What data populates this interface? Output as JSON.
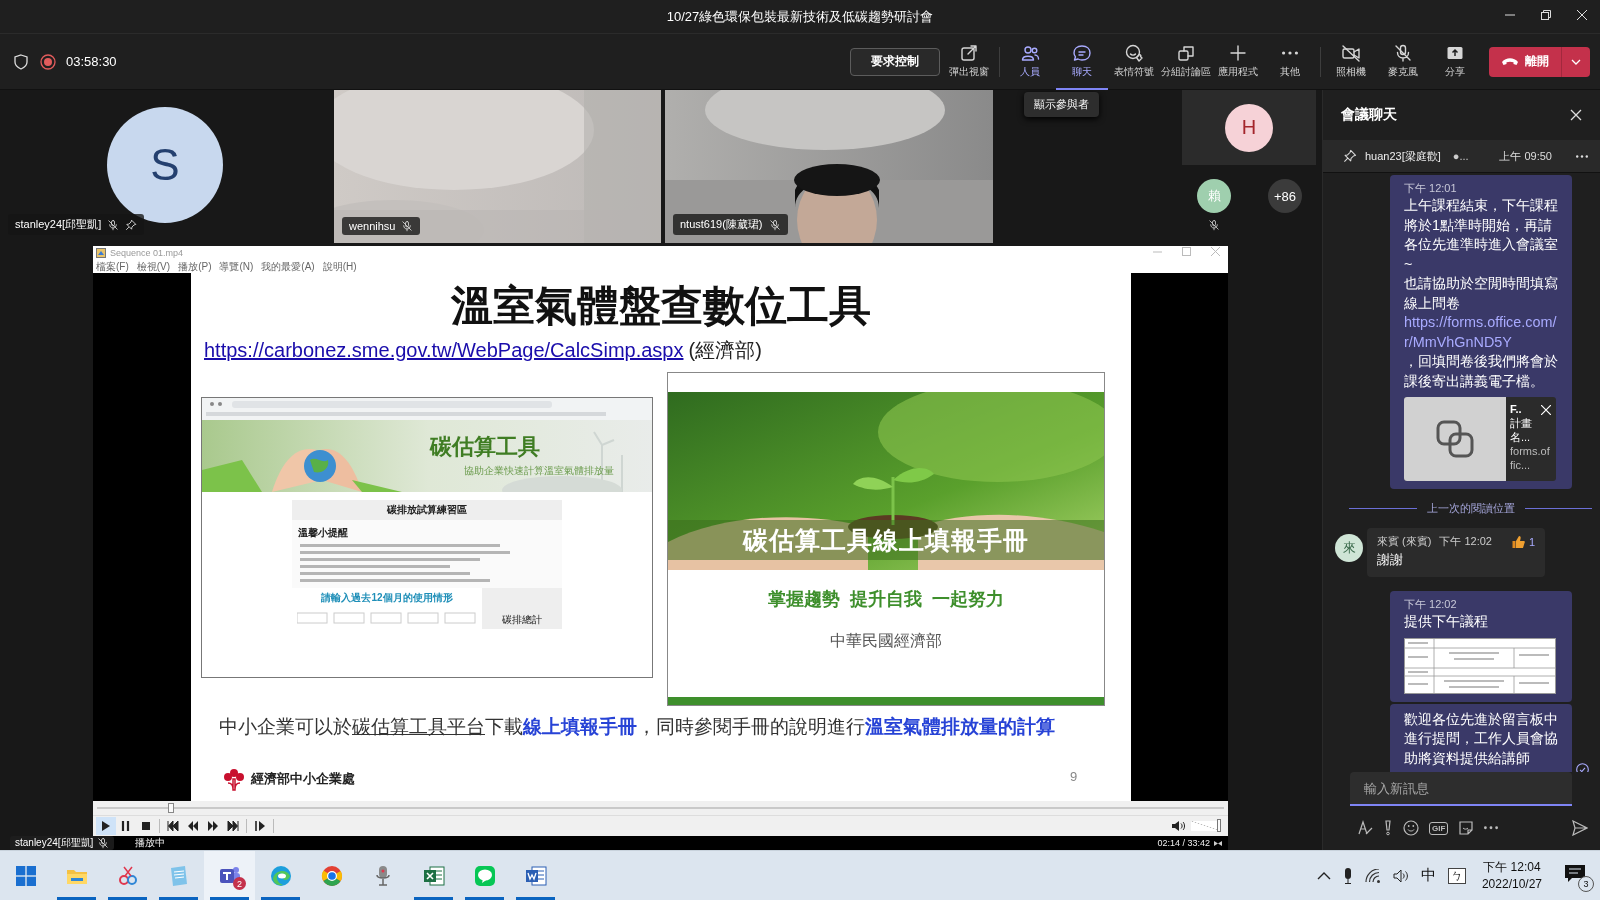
{
  "window": {
    "title": "10/27綠色環保包裝最新技術及低碳趨勢研討會"
  },
  "meeting_bar": {
    "elapsed": "03:58:30",
    "recording": true,
    "request_control": "要求控制",
    "tooltip": "顯示參與者",
    "actions": [
      {
        "label": "彈出視窗",
        "selected": false,
        "hovered": false
      },
      {
        "label": "人員",
        "selected": false,
        "hovered": true
      },
      {
        "label": "聊天",
        "selected": true,
        "hovered": false
      },
      {
        "label": "表情符號",
        "selected": false,
        "hovered": false
      },
      {
        "label": "分組討論區",
        "selected": false,
        "hovered": false
      },
      {
        "label": "應用程式",
        "selected": false,
        "hovered": false
      },
      {
        "label": "其他",
        "selected": false,
        "hovered": false
      }
    ],
    "devices": [
      {
        "label": "照相機",
        "off": true
      },
      {
        "label": "麥克風",
        "off": true
      },
      {
        "label": "分享",
        "off": false
      }
    ],
    "leave": "離開"
  },
  "participants": [
    {
      "kind": "avatar",
      "initial": "S",
      "name": "stanley24[邱聖凱]",
      "muted": true,
      "pinned": true
    },
    {
      "kind": "video",
      "name": "wennihsu",
      "muted": true,
      "pinned": false
    },
    {
      "kind": "video",
      "name": "ntust619(陳葳珺)",
      "muted": true,
      "pinned": false
    }
  ],
  "side_participants": {
    "avatars": [
      {
        "initial": "H",
        "color": "#f6d2d7",
        "muted": false
      },
      {
        "initial": "賴",
        "color": "#9fcfae",
        "muted": true
      }
    ],
    "overflow": "+86"
  },
  "shared_window": {
    "title": "Sequence 01.mp4",
    "menu": [
      "檔案(F)",
      "檢視(V)",
      "播放(P)",
      "導覽(N)",
      "我的最愛(A)",
      "說明(H)"
    ],
    "slide": {
      "title": "溫室氣體盤查數位工具",
      "link": "https://carbonez.sme.gov.tw/WebPage/CalcSimp.aspx",
      "link_note": "(經濟部)",
      "screenshot": {
        "heading": "碳估算工具",
        "subheading": "協助企業快速計算溫室氣體排放量",
        "form_title": "碳排放試算練習區",
        "tips_title": "溫馨小提醒",
        "input_title": "請輸入過去12個月的使用情形",
        "total": "碳排總計"
      },
      "cover": {
        "title": "碳估算工具線上填報手冊",
        "slogan": "掌握趨勢  提升自我  一起努力",
        "publisher": "中華民國經濟部"
      },
      "caption": [
        {
          "kind": "plain",
          "text": "中小企業可以於"
        },
        {
          "kind": "underline",
          "text": "碳估算工具平台"
        },
        {
          "kind": "plain",
          "text": "下載"
        },
        {
          "kind": "highlight",
          "text": "線上填報手冊"
        },
        {
          "kind": "plain",
          "text": "，同時參閱手冊的說明進行"
        },
        {
          "kind": "highlight",
          "text": "溫室氣體排放量的計算"
        }
      ],
      "footer": "經濟部中小企業處",
      "page": "9"
    },
    "player": {
      "progress": {
        "level": 0.066
      },
      "volume": {
        "level": 1
      },
      "status": "播放中",
      "time": "02:14 / 33:42"
    },
    "presenter": {
      "name": "stanley24[邱聖凱]",
      "muted": true
    }
  },
  "chat": {
    "title": "會議聊天",
    "pinned": {
      "sender": "huan23[梁庭歡]",
      "preview": "●...",
      "time": "上午 09:50"
    },
    "messages": [
      {
        "kind": "own",
        "time": "下午 12:01",
        "text": "上午課程結束，下午課程將於1點準時開始，再請各位先進準時進入會議室~\n也請協助於空閒時間填寫線上問卷",
        "link": "https://forms.office.com/r/MmVhGnND5Y",
        "after": "，回填問卷後我們將會於課後寄出講義電子檔。",
        "card": {
          "title": "F..",
          "subtitle": "計畫名...",
          "domain": "forms.offic..."
        },
        "seen": false
      },
      {
        "kind": "divider",
        "text": "上一次的閱讀位置"
      },
      {
        "kind": "other",
        "initial": "來",
        "sender": "來賓 (來賓)",
        "time": "下午 12:02",
        "reaction": {
          "count": "1"
        },
        "text": "謝謝"
      },
      {
        "time": "下午 12:02",
        "text": "提供下午議程",
        "seen": false
      },
      {
        "kind": "own",
        "text": "歡迎各位先進於留言板中進行提問，工作人員會協助將資料提供給講師",
        "seen": true
      }
    ],
    "composer": {
      "placeholder": "輸入新訊息",
      "gif": "GIF"
    }
  },
  "taskbar": {
    "apps": [
      {
        "running": true,
        "selected": false
      },
      {
        "running": true,
        "selected": false
      },
      {
        "running": true,
        "selected": false
      },
      {
        "running": true,
        "selected": true,
        "badge": "2"
      },
      {
        "running": true,
        "selected": false
      },
      {
        "running": false,
        "selected": false
      },
      {
        "running": false,
        "selected": false
      },
      {
        "running": true,
        "selected": false
      },
      {
        "running": true,
        "selected": false
      },
      {
        "running": true,
        "selected": false
      }
    ],
    "tray": {
      "ime": "中",
      "ime_mode": "ㄅ",
      "time": "下午 12:04",
      "date": "2022/10/27",
      "notifications": "3"
    }
  }
}
